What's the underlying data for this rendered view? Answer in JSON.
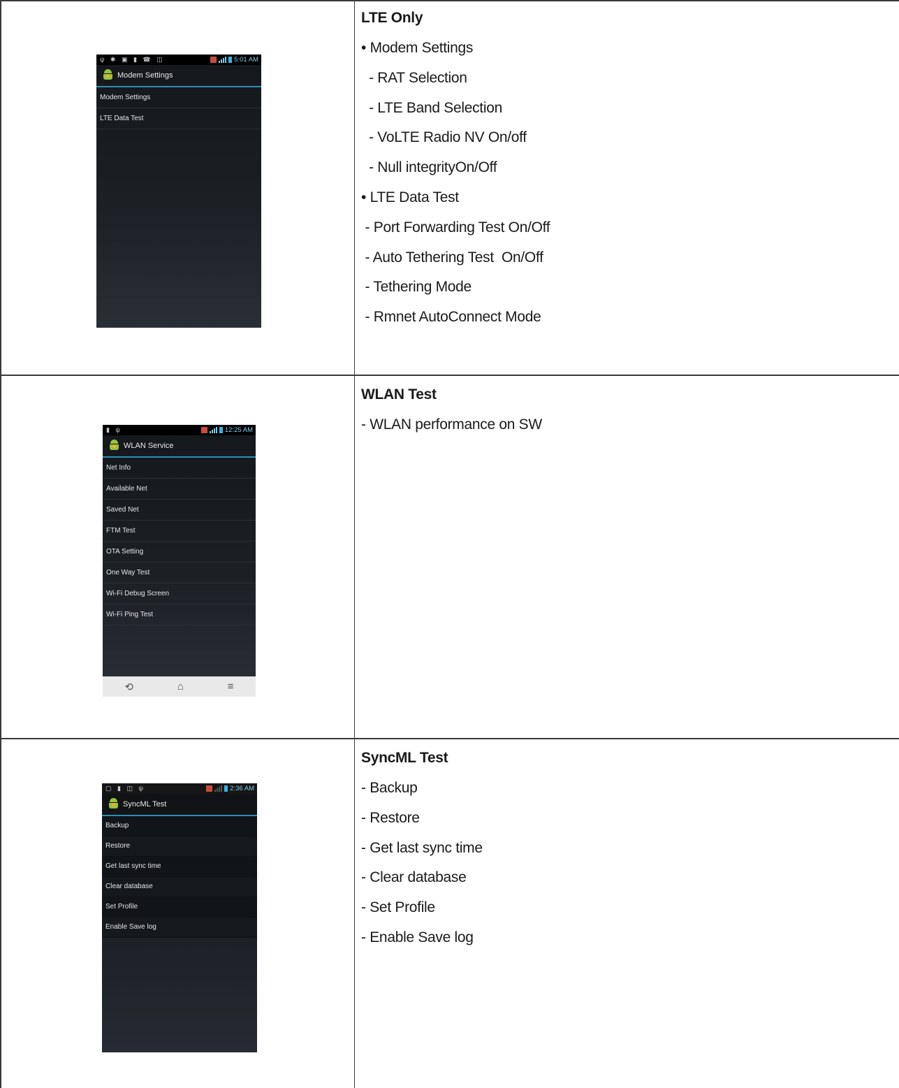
{
  "rows": [
    {
      "phone": {
        "time": "5:01 AM",
        "app_title": "Modem Settings",
        "menu": [
          "Modem Settings",
          "LTE Data Test"
        ]
      },
      "title": "LTE Only",
      "lines": [
        "• Modem Settings",
        "  - RAT Selection",
        "  - LTE Band Selection",
        "  - VoLTE Radio NV On/off",
        "  - Null integrityOn/Off",
        "• LTE Data Test",
        " - Port Forwarding Test On/Off",
        " - Auto Tethering Test  On/Off",
        " - Tethering Mode",
        " - Rmnet AutoConnect Mode"
      ]
    },
    {
      "phone": {
        "time": "12:25 AM",
        "app_title": "WLAN Service",
        "menu": [
          "Net Info",
          "Available Net",
          "Saved Net",
          "FTM Test",
          "OTA Setting",
          "One Way Test",
          "Wi-Fi Debug Screen",
          "Wi-Fi Ping Test"
        ],
        "nav": [
          "back-icon",
          "home-icon",
          "menu-icon"
        ]
      },
      "title": "WLAN Test",
      "lines": [
        "- WLAN performance on SW"
      ]
    },
    {
      "phone": {
        "time": "2:36 AM",
        "app_title": "SyncML Test",
        "menu": [
          "Backup",
          "Restore",
          "Get last sync time",
          "Clear database",
          "Set Profile",
          "Enable Save log"
        ]
      },
      "title": "SyncML Test",
      "lines": [
        "- Backup",
        "- Restore",
        "- Get last sync time",
        "- Clear database",
        "- Set Profile",
        "- Enable Save log"
      ]
    }
  ]
}
